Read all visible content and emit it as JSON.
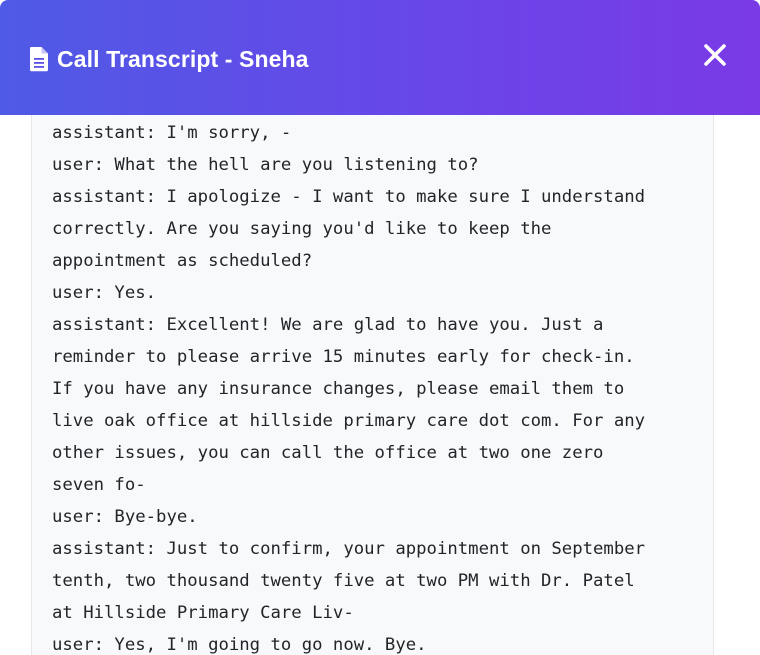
{
  "dialog": {
    "title": "Call Transcript - Sneha",
    "close_icon": "close-icon",
    "title_icon": "document-icon",
    "header_gradient": [
      "#4f5ae6",
      "#7a3ae6"
    ]
  },
  "transcript": {
    "lines": [
      " assistant: I'm sorry, -",
      " user: What the hell are you listening to?",
      " assistant: I apologize - I want to make sure I understand",
      "correctly. Are you saying you'd like to keep the",
      "appointment as scheduled?",
      " user: Yes.",
      " assistant: Excellent! We are glad to have you. Just a",
      "reminder to please arrive 15 minutes early for check-in.",
      "If you have any insurance changes, please email them to",
      "live oak office at hillside primary care dot com. For any",
      "other issues, you can call the office at two one zero",
      "seven fo-",
      " user: Bye-bye.",
      " assistant: Just to confirm, your appointment on September",
      "tenth, two thousand twenty five at two PM with Dr. Patel",
      "at Hillside Primary Care Liv-",
      " user: Yes, I'm going to go now. Bye."
    ]
  }
}
